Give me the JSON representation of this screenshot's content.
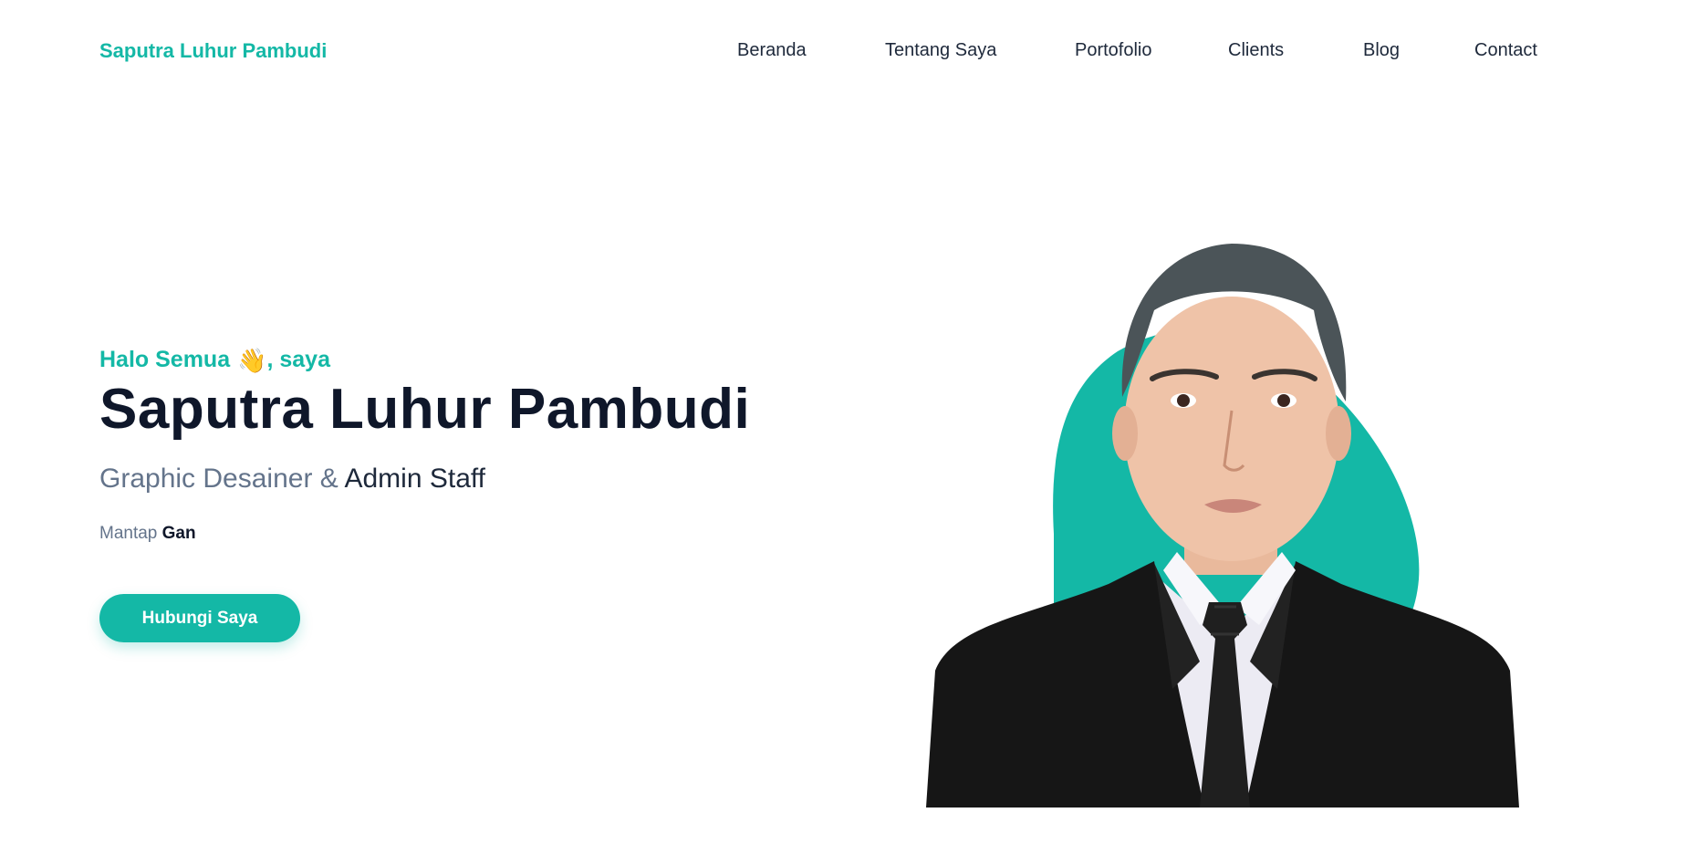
{
  "brand": {
    "name": "Saputra Luhur Pambudi",
    "color": "#14b8a6"
  },
  "nav": {
    "items": [
      {
        "label": "Beranda"
      },
      {
        "label": "Tentang Saya"
      },
      {
        "label": "Portofolio"
      },
      {
        "label": "Clients"
      },
      {
        "label": "Blog"
      },
      {
        "label": "Contact"
      }
    ]
  },
  "hero": {
    "greeting_prefix": "Halo Semua",
    "greeting_icon": "waving-hand-icon",
    "greeting_suffix": ", saya",
    "name": "Saputra Luhur Pambudi",
    "role_muted": "Graphic Desainer &",
    "role_strong": "Admin Staff",
    "tagline_muted": "Mantap",
    "tagline_bold": "Gan",
    "cta_label": "Hubungi Saya",
    "portrait_icon": "profile-photo"
  },
  "colors": {
    "accent": "#14b8a6",
    "heading": "#0f172a",
    "muted": "#64748b"
  }
}
